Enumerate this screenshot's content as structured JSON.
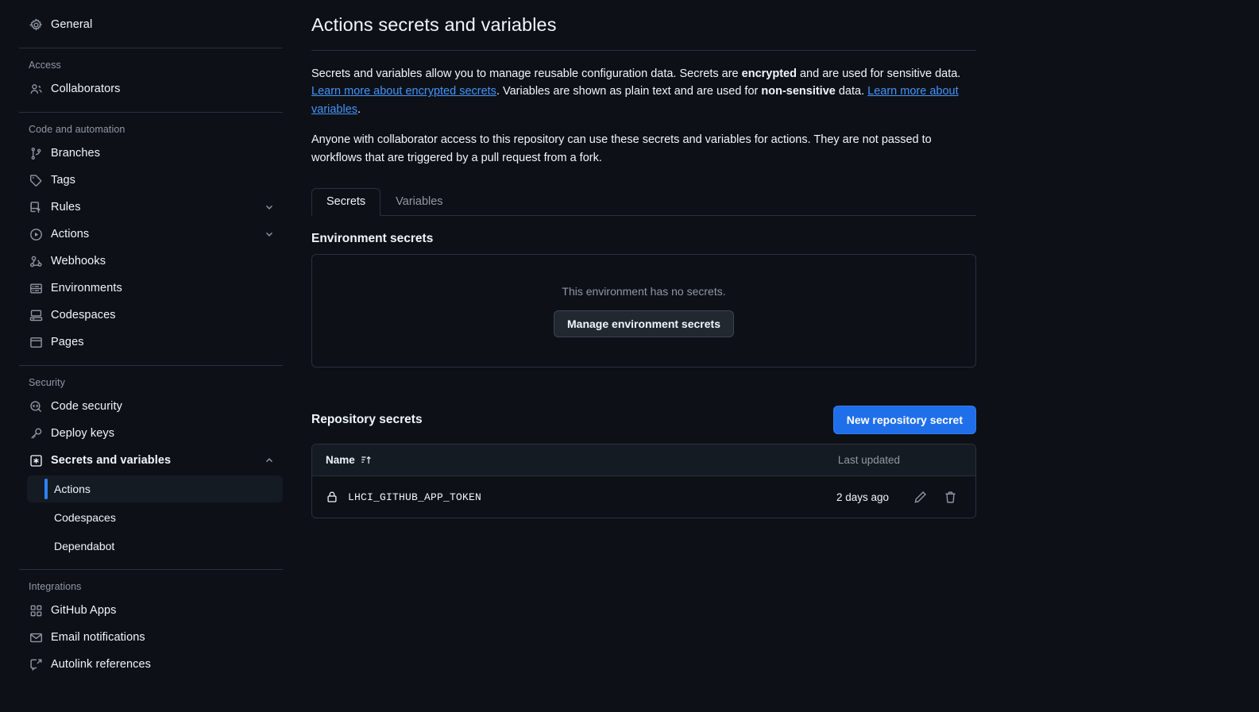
{
  "sidebar": {
    "top_items": [
      {
        "label": "General",
        "icon": "gear-icon",
        "name": "sidebar-item-general"
      }
    ],
    "groups": [
      {
        "label": "Access",
        "name": "sidebar-group-access",
        "items": [
          {
            "label": "Collaborators",
            "icon": "people-icon",
            "name": "sidebar-item-collaborators",
            "chevron": ""
          }
        ]
      },
      {
        "label": "Code and automation",
        "name": "sidebar-group-code-and-automation",
        "items": [
          {
            "label": "Branches",
            "icon": "git-branch-icon",
            "name": "sidebar-item-branches",
            "chevron": ""
          },
          {
            "label": "Tags",
            "icon": "tag-icon",
            "name": "sidebar-item-tags",
            "chevron": ""
          },
          {
            "label": "Rules",
            "icon": "rules-icon",
            "name": "sidebar-item-rules",
            "chevron": "down"
          },
          {
            "label": "Actions",
            "icon": "play-circle-icon",
            "name": "sidebar-item-actions",
            "chevron": "down"
          },
          {
            "label": "Webhooks",
            "icon": "webhook-icon",
            "name": "sidebar-item-webhooks",
            "chevron": ""
          },
          {
            "label": "Environments",
            "icon": "server-icon",
            "name": "sidebar-item-environments",
            "chevron": ""
          },
          {
            "label": "Codespaces",
            "icon": "codespaces-icon",
            "name": "sidebar-item-codespaces",
            "chevron": ""
          },
          {
            "label": "Pages",
            "icon": "browser-icon",
            "name": "sidebar-item-pages",
            "chevron": ""
          }
        ]
      },
      {
        "label": "Security",
        "name": "sidebar-group-security",
        "items": [
          {
            "label": "Code security",
            "icon": "codescan-icon",
            "name": "sidebar-item-code-security",
            "chevron": ""
          },
          {
            "label": "Deploy keys",
            "icon": "key-icon",
            "name": "sidebar-item-deploy-keys",
            "chevron": ""
          },
          {
            "label": "Secrets and variables",
            "icon": "asterisk-box-icon",
            "name": "sidebar-item-secrets-and-variables",
            "chevron": "up",
            "bold": true
          }
        ],
        "subitems": [
          {
            "label": "Actions",
            "name": "sidebar-subitem-actions",
            "selected": true
          },
          {
            "label": "Codespaces",
            "name": "sidebar-subitem-codespaces",
            "selected": false
          },
          {
            "label": "Dependabot",
            "name": "sidebar-subitem-dependabot",
            "selected": false
          }
        ]
      },
      {
        "label": "Integrations",
        "name": "sidebar-group-integrations",
        "items": [
          {
            "label": "GitHub Apps",
            "icon": "apps-icon",
            "name": "sidebar-item-github-apps",
            "chevron": ""
          },
          {
            "label": "Email notifications",
            "icon": "mail-icon",
            "name": "sidebar-item-email-notifications",
            "chevron": ""
          },
          {
            "label": "Autolink references",
            "icon": "cross-reference-icon",
            "name": "sidebar-item-autolink-references",
            "chevron": ""
          }
        ]
      }
    ]
  },
  "main": {
    "title": "Actions secrets and variables",
    "paragraph1": {
      "part1": "Secrets and variables allow you to manage reusable configuration data. Secrets are ",
      "bold1": "encrypted",
      "part2": " and are used for sensitive data. ",
      "link1": "Learn more about encrypted secrets",
      "part3": ". Variables are shown as plain text and are used for ",
      "bold2": "non-sensitive",
      "part4": " data. ",
      "link2": "Learn more about variables",
      "part5": "."
    },
    "paragraph2": "Anyone with collaborator access to this repository can use these secrets and variables for actions. They are not passed to workflows that are triggered by a pull request from a fork.",
    "tabs": [
      {
        "label": "Secrets",
        "name": "tab-secrets",
        "active": true
      },
      {
        "label": "Variables",
        "name": "tab-variables",
        "active": false
      }
    ],
    "environment_secrets": {
      "heading": "Environment secrets",
      "empty_message": "This environment has no secrets.",
      "manage_button": "Manage environment secrets"
    },
    "repository_secrets": {
      "heading": "Repository secrets",
      "new_button": "New repository secret",
      "columns": {
        "name": "Name",
        "last_updated": "Last updated"
      },
      "sort_icon": "sort-asc-icon",
      "rows": [
        {
          "icon": "lock-icon",
          "name": "LHCI_GITHUB_APP_TOKEN",
          "last_updated": "2 days ago",
          "edit_icon": "pencil-icon",
          "delete_icon": "trash-icon"
        }
      ]
    }
  },
  "colors": {
    "background": "#0d1117",
    "panel_border": "#2a3139",
    "accent_blue": "#2f81f7",
    "primary_button": "#1f6feb",
    "link": "#4493f8",
    "muted_text": "#9198a1",
    "text": "#f0f6fc",
    "selected_bg": "#151b23"
  }
}
